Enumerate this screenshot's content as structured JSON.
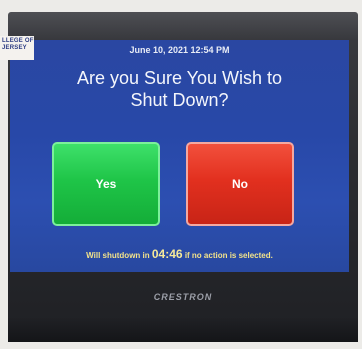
{
  "logo": {
    "text": "LLEGE OF\nJERSEY"
  },
  "status": {
    "datetime": "June 10, 2021 12:54 PM"
  },
  "dialog": {
    "prompt": "Are you Sure You Wish to\nShut Down?",
    "yes_label": "Yes",
    "no_label": "No"
  },
  "countdown": {
    "prefix": "Will shutdown in",
    "time": "04:46",
    "suffix": "if no action is selected."
  },
  "device": {
    "brand": "CRESTRON"
  },
  "colors": {
    "screen_bg": "#2848a8",
    "yes_button": "#1fc548",
    "no_button": "#e2301f",
    "countdown_text": "#f3e38a"
  }
}
